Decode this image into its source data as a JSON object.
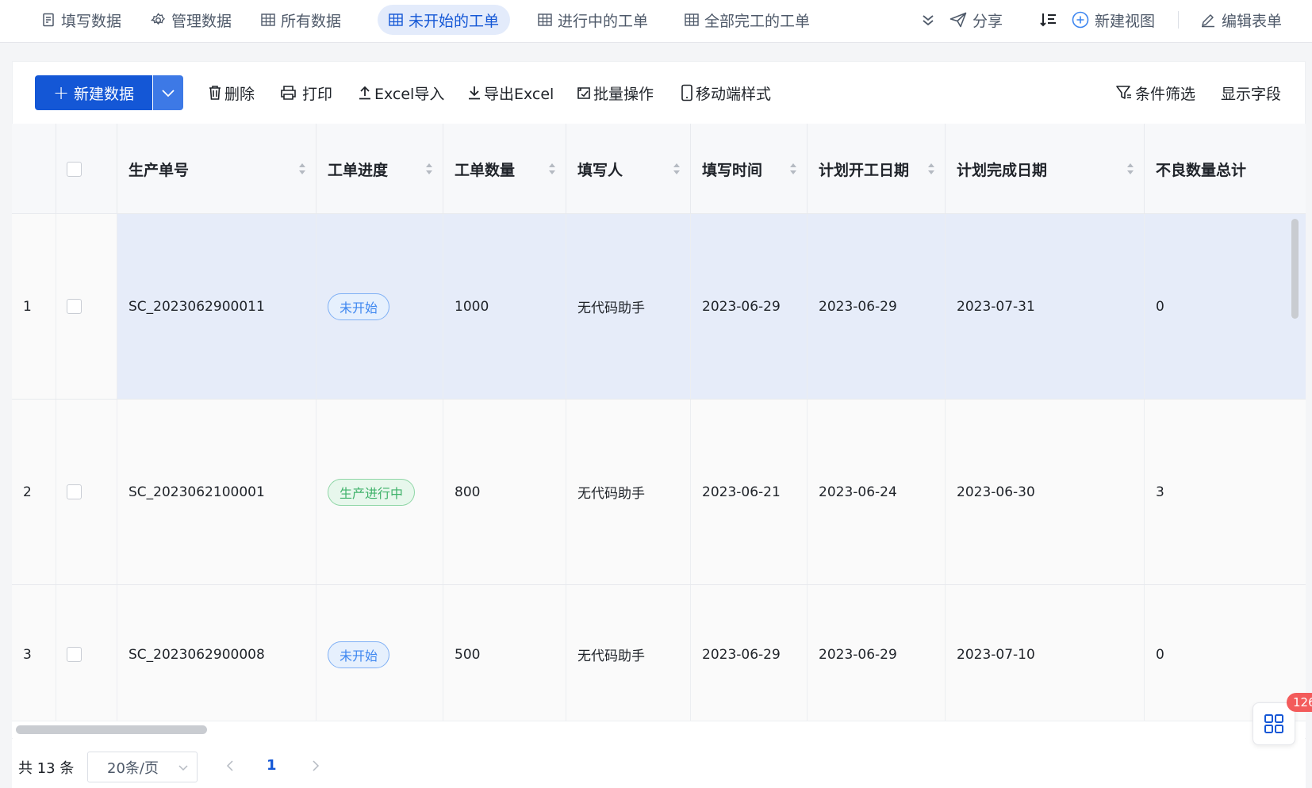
{
  "tabs": [
    {
      "label": "填写数据",
      "icon": "form-icon"
    },
    {
      "label": "管理数据",
      "icon": "gear-icon"
    },
    {
      "label": "所有数据",
      "icon": "table-icon"
    },
    {
      "label": "未开始的工单",
      "icon": "table-icon",
      "active": true
    },
    {
      "label": "进行中的工单",
      "icon": "table-icon"
    },
    {
      "label": "全部完工的工单",
      "icon": "table-icon"
    }
  ],
  "topbar": {
    "share_label": "分享",
    "new_view_label": "新建视图",
    "edit_form_label": "编辑表单"
  },
  "toolbar": {
    "new_label": "新建数据",
    "delete_label": "删除",
    "print_label": "打印",
    "import_label": "Excel导入",
    "export_label": "导出Excel",
    "batch_label": "批量操作",
    "mobile_label": "移动端样式",
    "filter_label": "条件筛选",
    "fields_label": "显示字段"
  },
  "columns": [
    "生产单号",
    "工单进度",
    "工单数量",
    "填写人",
    "填写时间",
    "计划开工日期",
    "计划完成日期",
    "不良数量总计"
  ],
  "rows": [
    {
      "index": "1",
      "order_no": "SC_2023062900011",
      "status": "未开始",
      "status_color": "#3d86f0",
      "qty": "1000",
      "author": "无代码助手",
      "filled": "2023-06-29",
      "plan_start": "2023-06-29",
      "plan_end": "2023-07-31",
      "defects": "0",
      "selected": true
    },
    {
      "index": "2",
      "order_no": "SC_2023062100001",
      "status": "生产进行中",
      "status_color": "#3fb26a",
      "qty": "800",
      "author": "无代码助手",
      "filled": "2023-06-21",
      "plan_start": "2023-06-24",
      "plan_end": "2023-06-30",
      "defects": "3",
      "selected": false
    },
    {
      "index": "3",
      "order_no": "SC_2023062900008",
      "status": "未开始",
      "status_color": "#3d86f0",
      "qty": "500",
      "author": "无代码助手",
      "filled": "2023-06-29",
      "plan_start": "2023-06-29",
      "plan_end": "2023-07-10",
      "defects": "0",
      "selected": false
    }
  ],
  "pagination": {
    "total": "共 13 条",
    "page_size": "20条/页",
    "current": "1"
  },
  "fab": {
    "badge": "126",
    "icon": "grid-apps-icon"
  },
  "colors": {
    "accent": "#1457d6",
    "selected_row": "#e6ecf9",
    "tag_blue": "#3d86f0",
    "tag_green": "#3fb26a"
  }
}
